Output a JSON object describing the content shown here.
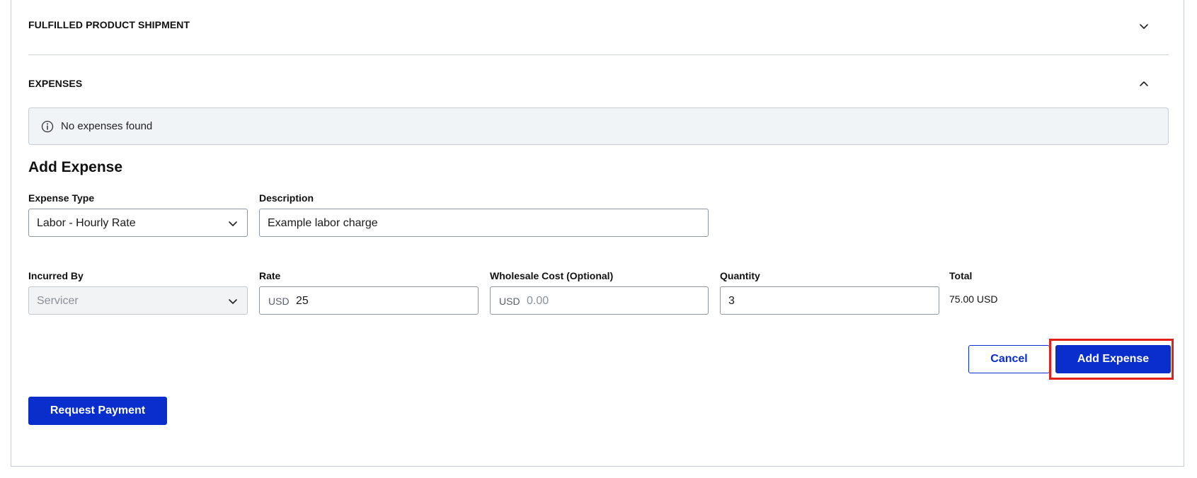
{
  "sections": {
    "fulfilled": {
      "title": "FULFILLED PRODUCT SHIPMENT",
      "icon": "chevron-down-icon"
    },
    "expenses": {
      "title": "EXPENSES",
      "icon": "chevron-up-icon"
    }
  },
  "alert": {
    "icon": "info-icon",
    "text": "No expenses found"
  },
  "add_expense": {
    "heading": "Add Expense",
    "expense_type": {
      "label": "Expense Type",
      "value": "Labor - Hourly Rate"
    },
    "description": {
      "label": "Description",
      "value": "Example labor charge"
    },
    "incurred_by": {
      "label": "Incurred By",
      "value": "Servicer"
    },
    "rate": {
      "label": "Rate",
      "currency": "USD",
      "value": "25"
    },
    "wholesale": {
      "label": "Wholesale Cost (Optional)",
      "currency": "USD",
      "placeholder": "0.00"
    },
    "quantity": {
      "label": "Quantity",
      "value": "3"
    },
    "total": {
      "label": "Total",
      "value": "75.00 USD"
    },
    "cancel_label": "Cancel",
    "submit_label": "Add Expense"
  },
  "request_payment_label": "Request Payment",
  "colors": {
    "primary": "#0a2ecc",
    "highlight": "#e3201c",
    "alert_bg": "#f1f4f7"
  }
}
